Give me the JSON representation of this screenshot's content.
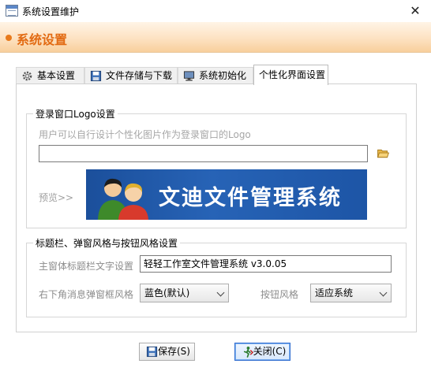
{
  "window": {
    "title": "系统设置维护",
    "close_glyph": "✕"
  },
  "banner": {
    "title": "系统设置"
  },
  "tabs": [
    {
      "label": "基本设置",
      "icon": "gear-icon"
    },
    {
      "label": "文件存储与下载",
      "icon": "save-icon"
    },
    {
      "label": "系统初始化",
      "icon": "monitor-icon"
    },
    {
      "label": "个性化界面设置",
      "active": true
    }
  ],
  "logo_group": {
    "title": "登录窗口Logo设置",
    "hint": "用户可以自行设计个性化图片作为登录窗口的Logo",
    "path_value": "",
    "preview_label": "预览>>",
    "logo_text": "文迪文件管理系统"
  },
  "style_group": {
    "title": "标题栏、弹窗风格与按钮风格设置",
    "caption_label": "主窗体标题栏文字设置",
    "caption_value": "轻轻工作室文件管理系统 v3.0.05",
    "popup_label": "右下角消息弹窗框风格",
    "popup_value": "蓝色(默认)",
    "button_style_label": "按钮风格",
    "button_style_value": "适应系统"
  },
  "buttons": {
    "save": "保存(S)",
    "close": "关闭(C)"
  },
  "colors": {
    "banner_text": "#e26a12",
    "logo_bg": "#1f58a8",
    "focus_border": "#2f6ccf"
  }
}
